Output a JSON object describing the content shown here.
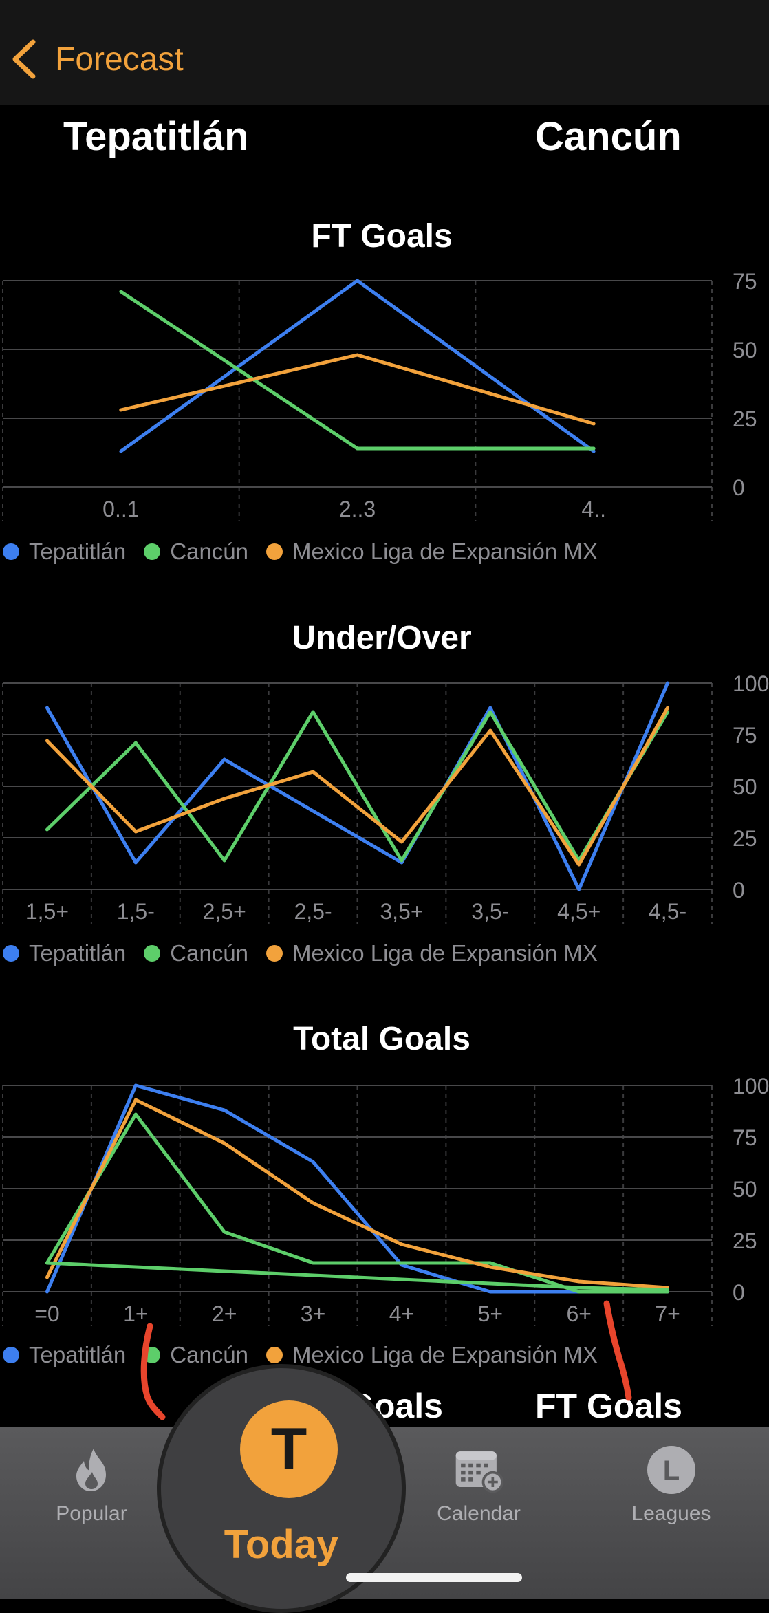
{
  "nav": {
    "back_label": "Forecast"
  },
  "teams": {
    "home": "Tepatitlán",
    "away": "Cancún"
  },
  "legend": {
    "home": "Tepatitlán",
    "away": "Cancún",
    "league": "Mexico Liga de Expansión MX"
  },
  "colors": {
    "home": "#3d7ff0",
    "away": "#5dce6a",
    "league": "#f2a23c",
    "accent": "#f2a23c"
  },
  "chart_data": [
    {
      "type": "line",
      "title": "FT Goals",
      "categories": [
        "0..1",
        "2..3",
        "4.."
      ],
      "ylim": [
        0,
        75
      ],
      "yticks": [
        "0",
        "25",
        "50",
        "75"
      ],
      "grid": true,
      "legend_position": "bottom-left",
      "series": [
        {
          "name": "Tepatitlán",
          "values": [
            13,
            75,
            13
          ]
        },
        {
          "name": "Cancún",
          "values": [
            71,
            14,
            14
          ]
        },
        {
          "name": "Mexico Liga de Expansión MX",
          "values": [
            28,
            48,
            23
          ]
        }
      ]
    },
    {
      "type": "line",
      "title": "Under/Over",
      "categories": [
        "1,5+",
        "1,5-",
        "2,5+",
        "2,5-",
        "3,5+",
        "3,5-",
        "4,5+",
        "4,5-"
      ],
      "ylim": [
        0,
        100
      ],
      "yticks": [
        "0",
        "25",
        "50",
        "75",
        "100"
      ],
      "grid": true,
      "legend_position": "bottom-left",
      "series": [
        {
          "name": "Tepatitlán",
          "values": [
            88,
            13,
            63,
            38,
            13,
            88,
            0,
            100
          ]
        },
        {
          "name": "Cancún",
          "values": [
            29,
            71,
            14,
            86,
            14,
            86,
            14,
            86
          ]
        },
        {
          "name": "Mexico Liga de Expansión MX",
          "values": [
            72,
            28,
            44,
            57,
            23,
            77,
            12,
            88
          ]
        }
      ]
    },
    {
      "type": "line",
      "title": "Total Goals",
      "categories": [
        "=0",
        "1+",
        "2+",
        "3+",
        "4+",
        "5+",
        "6+",
        "7+"
      ],
      "ylim": [
        0,
        100
      ],
      "yticks": [
        "0",
        "25",
        "50",
        "75",
        "100"
      ],
      "grid": true,
      "legend_position": "bottom-left",
      "series": [
        {
          "name": "Tepatitlán",
          "values": [
            0,
            100,
            88,
            63,
            13,
            0,
            0,
            0
          ]
        },
        {
          "name": "Cancún",
          "values": [
            14,
            86,
            29,
            14,
            14,
            14,
            0,
            0
          ]
        },
        {
          "name": "Mexico Liga de Expansión MX",
          "values": [
            7,
            93,
            72,
            43,
            23,
            12,
            5,
            2
          ]
        },
        {
          "name": "",
          "values": [
            14,
            12,
            10,
            8,
            6,
            4,
            2,
            1
          ]
        }
      ]
    }
  ],
  "next_section": {
    "left_title": "Goals",
    "right_title": "FT Goals"
  },
  "tabs": [
    {
      "label": "Popular",
      "icon": "flame-icon"
    },
    {
      "label": "Today",
      "icon": "today-t-icon"
    },
    {
      "label": "Calendar",
      "icon": "calendar-add-icon"
    },
    {
      "label": "Leagues",
      "icon": "leagues-l-icon"
    }
  ],
  "today_badge": "T",
  "leagues_badge": "L",
  "annotation_color": "#e8452c"
}
